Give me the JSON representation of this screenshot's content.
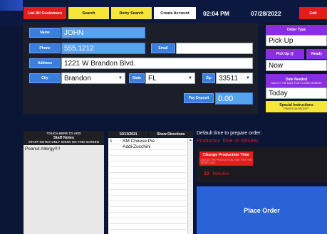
{
  "toolbar": {
    "list_all": "List All Customers",
    "search": "Search",
    "retry": "Retry Search",
    "create": "Create Account",
    "exit": "Exit"
  },
  "status": {
    "time": "02:04 PM",
    "date": "07/28/2022"
  },
  "customer": {
    "name_label": "Name",
    "name": "JOHN",
    "phone_label": "Phone",
    "phone": "555.1212",
    "email_label": "Email",
    "email": "",
    "address_label": "Address",
    "address": "1221 W Brandon Blvd.",
    "city_label": "City",
    "city": "Brandon",
    "state_label": "State",
    "state": "FL",
    "zip_label": "Zip",
    "zip": "33511",
    "pay_label": "Pay Deposit",
    "pay": "0.00"
  },
  "order": {
    "type_label": "Order Type",
    "type": "Pick Up",
    "pickup_label": "Pick Up @",
    "ready_label": "Ready",
    "pickup": "Now",
    "date_label": "Date Needed",
    "date_sub": "SELECT THE DATE FOR FUTURE ORDERS",
    "date": "Today",
    "special_label": "Special Instructions",
    "special_sub": "PRINTS ON RECEIPT"
  },
  "notes": {
    "header1": "TOUCH HERE TO ADD",
    "header2": "Staff Notes",
    "header3": "STAFF NOTES ONLY SHOW ON THIS SCREEN",
    "text": "Peanut Allergy!!!!"
  },
  "items": {
    "date": "10/13/2021",
    "show_directions": "Show Directions",
    "lines": [
      {
        "qty": "1",
        "text": "SM Cheese Pie"
      },
      {
        "qty": "",
        "text": "Addi-Zucchini"
      }
    ]
  },
  "prep": {
    "default_text": "Default time to prepare order:",
    "production_time": "Production Time 20 Minutes",
    "change_title": "Change Production Time",
    "change_sub": "CHANGE THE PRODUCTION TIME FOR THIS ORDER ONLY",
    "minutes": "10",
    "minutes_label": "Minutes",
    "place_order": "Place Order"
  },
  "colors": {
    "background": "#0b1535",
    "accent_blue": "#3a7fe0",
    "accent_red": "#e31c1c",
    "accent_yellow": "#f7e53a",
    "accent_purple": "#8a2ee0"
  }
}
